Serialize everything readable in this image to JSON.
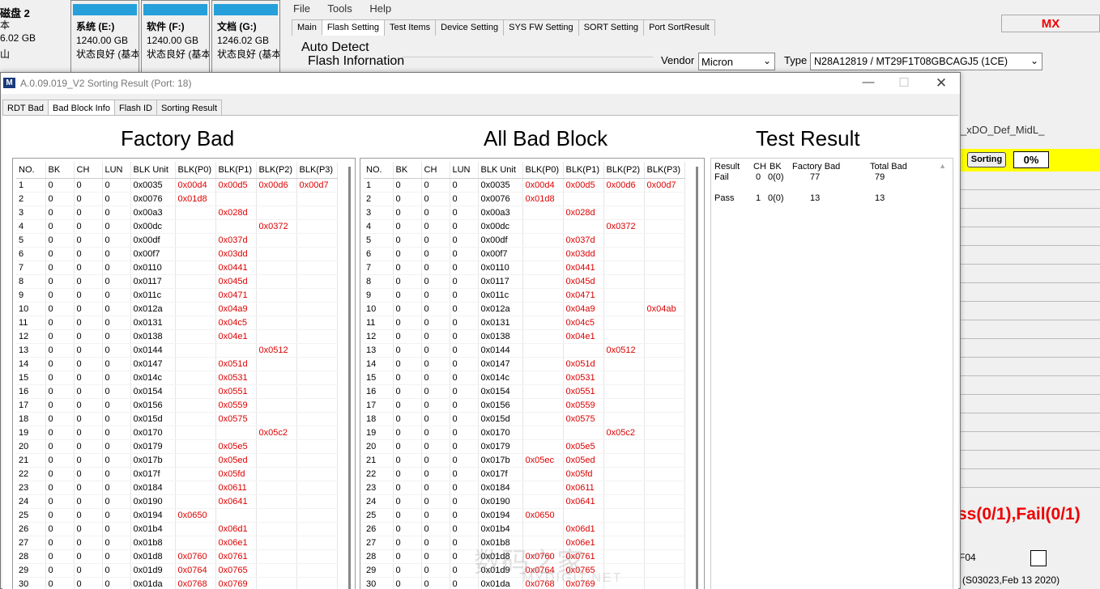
{
  "explorer": {
    "disk": "磁盘 2",
    "sub1": "本",
    "sub2": "6.02 GB",
    "sub3": "山",
    "drives": [
      {
        "name": "系统 (E:)",
        "size": "1240.00 GB",
        "status": "状态良好 (基本"
      },
      {
        "name": "软件 (F:)",
        "size": "1240.00 GB",
        "status": "状态良好 (基本"
      },
      {
        "name": "文档 (G:)",
        "size": "1246.02 GB",
        "status": "状态良好 (基本"
      }
    ]
  },
  "main": {
    "menu": [
      "File",
      "Tools",
      "Help"
    ],
    "tabs": [
      "Main",
      "Flash Setting",
      "Test Items",
      "Device Setting",
      "SYS FW Setting",
      "SORT Setting",
      "Port SortResult"
    ],
    "mx": "MX",
    "auto_detect": "Auto Detect",
    "flash_info": "Flash Infornation",
    "vendor_label": "Vendor",
    "vendor": "Micron",
    "type_label": "Type",
    "type": "N28A12819  /  MT29F1T08GBCAGJ5 (1CE)",
    "xdo": "_xDO_Def_MidL_",
    "sorting": "Sorting",
    "percent": "0%",
    "passfail": "ss(0/1),Fail(0/1)",
    "f04": "F04",
    "version": "(S03023,Feb 13 2020)"
  },
  "popup": {
    "title": "A.0.09.019_V2 Sorting Result (Port: 18)",
    "icon": "M",
    "tabs": [
      "RDT Bad",
      "Bad Block Info",
      "Flash ID",
      "Sorting Result"
    ],
    "factory_title": "Factory Bad",
    "allbad_title": "All Bad Block",
    "result_title": "Test Result",
    "headers": [
      "NO.",
      "BK",
      "CH",
      "LUN",
      "BLK Unit",
      "BLK(P0)",
      "BLK(P1)",
      "BLK(P2)",
      "BLK(P3)"
    ],
    "factory_rows": [
      [
        "1",
        "0",
        "0",
        "0",
        "0x0035",
        "0x00d4",
        "0x00d5",
        "0x00d6",
        "0x00d7"
      ],
      [
        "2",
        "0",
        "0",
        "0",
        "0x0076",
        "0x01d8",
        "",
        "",
        ""
      ],
      [
        "3",
        "0",
        "0",
        "0",
        "0x00a3",
        "",
        "0x028d",
        "",
        ""
      ],
      [
        "4",
        "0",
        "0",
        "0",
        "0x00dc",
        "",
        "",
        "0x0372",
        ""
      ],
      [
        "5",
        "0",
        "0",
        "0",
        "0x00df",
        "",
        "0x037d",
        "",
        ""
      ],
      [
        "6",
        "0",
        "0",
        "0",
        "0x00f7",
        "",
        "0x03dd",
        "",
        ""
      ],
      [
        "7",
        "0",
        "0",
        "0",
        "0x0110",
        "",
        "0x0441",
        "",
        ""
      ],
      [
        "8",
        "0",
        "0",
        "0",
        "0x0117",
        "",
        "0x045d",
        "",
        ""
      ],
      [
        "9",
        "0",
        "0",
        "0",
        "0x011c",
        "",
        "0x0471",
        "",
        ""
      ],
      [
        "10",
        "0",
        "0",
        "0",
        "0x012a",
        "",
        "0x04a9",
        "",
        ""
      ],
      [
        "11",
        "0",
        "0",
        "0",
        "0x0131",
        "",
        "0x04c5",
        "",
        ""
      ],
      [
        "12",
        "0",
        "0",
        "0",
        "0x0138",
        "",
        "0x04e1",
        "",
        ""
      ],
      [
        "13",
        "0",
        "0",
        "0",
        "0x0144",
        "",
        "",
        "0x0512",
        ""
      ],
      [
        "14",
        "0",
        "0",
        "0",
        "0x0147",
        "",
        "0x051d",
        "",
        ""
      ],
      [
        "15",
        "0",
        "0",
        "0",
        "0x014c",
        "",
        "0x0531",
        "",
        ""
      ],
      [
        "16",
        "0",
        "0",
        "0",
        "0x0154",
        "",
        "0x0551",
        "",
        ""
      ],
      [
        "17",
        "0",
        "0",
        "0",
        "0x0156",
        "",
        "0x0559",
        "",
        ""
      ],
      [
        "18",
        "0",
        "0",
        "0",
        "0x015d",
        "",
        "0x0575",
        "",
        ""
      ],
      [
        "19",
        "0",
        "0",
        "0",
        "0x0170",
        "",
        "",
        "0x05c2",
        ""
      ],
      [
        "20",
        "0",
        "0",
        "0",
        "0x0179",
        "",
        "0x05e5",
        "",
        ""
      ],
      [
        "21",
        "0",
        "0",
        "0",
        "0x017b",
        "",
        "0x05ed",
        "",
        ""
      ],
      [
        "22",
        "0",
        "0",
        "0",
        "0x017f",
        "",
        "0x05fd",
        "",
        ""
      ],
      [
        "23",
        "0",
        "0",
        "0",
        "0x0184",
        "",
        "0x0611",
        "",
        ""
      ],
      [
        "24",
        "0",
        "0",
        "0",
        "0x0190",
        "",
        "0x0641",
        "",
        ""
      ],
      [
        "25",
        "0",
        "0",
        "0",
        "0x0194",
        "0x0650",
        "",
        "",
        ""
      ],
      [
        "26",
        "0",
        "0",
        "0",
        "0x01b4",
        "",
        "0x06d1",
        "",
        ""
      ],
      [
        "27",
        "0",
        "0",
        "0",
        "0x01b8",
        "",
        "0x06e1",
        "",
        ""
      ],
      [
        "28",
        "0",
        "0",
        "0",
        "0x01d8",
        "0x0760",
        "0x0761",
        "",
        ""
      ],
      [
        "29",
        "0",
        "0",
        "0",
        "0x01d9",
        "0x0764",
        "0x0765",
        "",
        ""
      ],
      [
        "30",
        "0",
        "0",
        "0",
        "0x01da",
        "0x0768",
        "0x0769",
        "",
        ""
      ]
    ],
    "allbad_rows": [
      [
        "1",
        "0",
        "0",
        "0",
        "0x0035",
        "0x00d4",
        "0x00d5",
        "0x00d6",
        "0x00d7"
      ],
      [
        "2",
        "0",
        "0",
        "0",
        "0x0076",
        "0x01d8",
        "",
        "",
        ""
      ],
      [
        "3",
        "0",
        "0",
        "0",
        "0x00a3",
        "",
        "0x028d",
        "",
        ""
      ],
      [
        "4",
        "0",
        "0",
        "0",
        "0x00dc",
        "",
        "",
        "0x0372",
        ""
      ],
      [
        "5",
        "0",
        "0",
        "0",
        "0x00df",
        "",
        "0x037d",
        "",
        ""
      ],
      [
        "6",
        "0",
        "0",
        "0",
        "0x00f7",
        "",
        "0x03dd",
        "",
        ""
      ],
      [
        "7",
        "0",
        "0",
        "0",
        "0x0110",
        "",
        "0x0441",
        "",
        ""
      ],
      [
        "8",
        "0",
        "0",
        "0",
        "0x0117",
        "",
        "0x045d",
        "",
        ""
      ],
      [
        "9",
        "0",
        "0",
        "0",
        "0x011c",
        "",
        "0x0471",
        "",
        ""
      ],
      [
        "10",
        "0",
        "0",
        "0",
        "0x012a",
        "",
        "0x04a9",
        "",
        "0x04ab"
      ],
      [
        "11",
        "0",
        "0",
        "0",
        "0x0131",
        "",
        "0x04c5",
        "",
        ""
      ],
      [
        "12",
        "0",
        "0",
        "0",
        "0x0138",
        "",
        "0x04e1",
        "",
        ""
      ],
      [
        "13",
        "0",
        "0",
        "0",
        "0x0144",
        "",
        "",
        "0x0512",
        ""
      ],
      [
        "14",
        "0",
        "0",
        "0",
        "0x0147",
        "",
        "0x051d",
        "",
        ""
      ],
      [
        "15",
        "0",
        "0",
        "0",
        "0x014c",
        "",
        "0x0531",
        "",
        ""
      ],
      [
        "16",
        "0",
        "0",
        "0",
        "0x0154",
        "",
        "0x0551",
        "",
        ""
      ],
      [
        "17",
        "0",
        "0",
        "0",
        "0x0156",
        "",
        "0x0559",
        "",
        ""
      ],
      [
        "18",
        "0",
        "0",
        "0",
        "0x015d",
        "",
        "0x0575",
        "",
        ""
      ],
      [
        "19",
        "0",
        "0",
        "0",
        "0x0170",
        "",
        "",
        "0x05c2",
        ""
      ],
      [
        "20",
        "0",
        "0",
        "0",
        "0x0179",
        "",
        "0x05e5",
        "",
        ""
      ],
      [
        "21",
        "0",
        "0",
        "0",
        "0x017b",
        "0x05ec",
        "0x05ed",
        "",
        ""
      ],
      [
        "22",
        "0",
        "0",
        "0",
        "0x017f",
        "",
        "0x05fd",
        "",
        ""
      ],
      [
        "23",
        "0",
        "0",
        "0",
        "0x0184",
        "",
        "0x0611",
        "",
        ""
      ],
      [
        "24",
        "0",
        "0",
        "0",
        "0x0190",
        "",
        "0x0641",
        "",
        ""
      ],
      [
        "25",
        "0",
        "0",
        "0",
        "0x0194",
        "0x0650",
        "",
        "",
        ""
      ],
      [
        "26",
        "0",
        "0",
        "0",
        "0x01b4",
        "",
        "0x06d1",
        "",
        ""
      ],
      [
        "27",
        "0",
        "0",
        "0",
        "0x01b8",
        "",
        "0x06e1",
        "",
        ""
      ],
      [
        "28",
        "0",
        "0",
        "0",
        "0x01d8",
        "0x0760",
        "0x0761",
        "",
        ""
      ],
      [
        "29",
        "0",
        "0",
        "0",
        "0x01d9",
        "0x0764",
        "0x0765",
        "",
        ""
      ],
      [
        "30",
        "0",
        "0",
        "0",
        "0x01da",
        "0x0768",
        "0x0769",
        "",
        ""
      ]
    ],
    "result": {
      "headers": [
        "Result",
        "CH",
        "BK",
        "Factory Bad",
        "Total Bad"
      ],
      "rows": [
        [
          "Fail",
          "0",
          "0(0)",
          "77",
          "79"
        ],
        [
          "Pass",
          "1",
          "0(0)",
          "13",
          "13"
        ]
      ]
    },
    "watermark": "数码之家",
    "watermark2": "MYDIGIT.NET"
  },
  "colors": {
    "bad": "#d00000",
    "highlight": "#ffff00",
    "accent": "#e00000"
  }
}
